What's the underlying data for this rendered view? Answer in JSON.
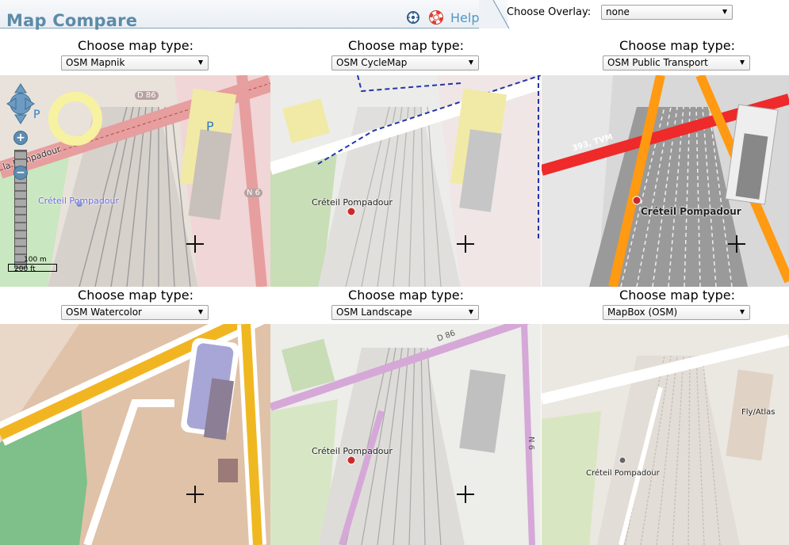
{
  "header": {
    "title": "Map Compare",
    "help_label": "Help",
    "overlay_label": "Choose Overlay:",
    "overlay_value": "none"
  },
  "panels": [
    {
      "caption": "Choose map type:",
      "selected": "OSM Mapnik"
    },
    {
      "caption": "Choose map type:",
      "selected": "OSM CycleMap"
    },
    {
      "caption": "Choose map type:",
      "selected": "OSM Public Transport"
    },
    {
      "caption": "Choose map type:",
      "selected": "OSM Watercolor"
    },
    {
      "caption": "Choose map type:",
      "selected": "OSM Landscape"
    },
    {
      "caption": "Choose map type:",
      "selected": "MapBox (OSM)"
    }
  ],
  "map_labels": {
    "place": "Créteil Pompadour",
    "road_d86": "D 86",
    "road_n6": "N 6",
    "pompadour_road": "la Pompadour",
    "parking": "P",
    "bus_line": "393, TVM",
    "fly_atlas": "Fly/Atlas",
    "scale_m": "100 m",
    "scale_ft": "200 ft"
  },
  "icons": {
    "compass": "compass-icon",
    "help": "lifebuoy-icon",
    "crosshair": "crosshair-icon"
  },
  "colors": {
    "title": "#5d8ba8",
    "help": "#4f97c8",
    "tab_border": "#7fa3bf"
  }
}
